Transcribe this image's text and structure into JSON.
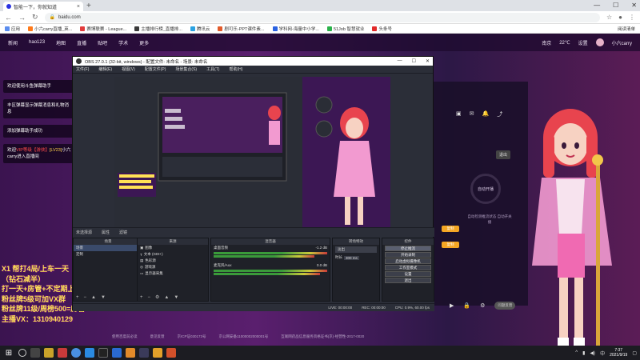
{
  "browser": {
    "tab_title": "智能一下，你就知道",
    "address": "baidu.com",
    "bookmarks": [
      "应用",
      "小六carry直播_英...",
      "赛博联赛 - League...",
      "主播排行榜_直播排...",
      "腾讯云",
      "剧可乐-PPT课件素...",
      "学科网-海量中小学...",
      "51Job 智慧就业",
      "头条号"
    ],
    "bookmarks_right": "阅读清单"
  },
  "site_nav": {
    "items": [
      "新闻",
      "hao123",
      "地图",
      "直播",
      "贴吧",
      "学术",
      "更多"
    ],
    "right": [
      "南京",
      "22℃",
      "设置",
      "小六carry"
    ]
  },
  "chat": [
    {
      "text": "欢迎使用斗鱼弹幕助手"
    },
    {
      "text": "丰区弹幕显示弹幕消息和礼物消息"
    },
    {
      "text": "添加弹幕助手成功"
    },
    {
      "pre": "欢迎",
      "hl": "VIP等级",
      "mid": "【游侠】",
      "lvl": "[LV23]",
      "post": "小六carry进入直播间"
    }
  ],
  "promo": [
    "X1 帮打4局/上车一天",
    "（钻石减半）",
    "打一天+房管+不定期上分",
    "粉丝牌5级可加VX群",
    "粉丝牌11级/周榜500=房管",
    "主播VX：1310940129"
  ],
  "obs": {
    "title": "OBS 27.0.1 (32-bit, windows) - 配置文件: 未命名 - 场景: 未命名",
    "menu": [
      "文件(F)",
      "编辑(E)",
      "视图(V)",
      "配置文件(P)",
      "场景集合(S)",
      "工具(T)",
      "帮助(H)"
    ],
    "selection_bar": [
      "未选择源",
      "属性",
      "滤镜"
    ],
    "scenes_header": "场景",
    "scenes": [
      "场景",
      "定制"
    ],
    "sources_header": "来源",
    "sources": [
      "图像",
      "文本 (GDI+)",
      "色彩源",
      "游戏源",
      "显示器采集"
    ],
    "mixer_header": "混音器",
    "mixer": [
      {
        "name": "桌面音频",
        "db": "-1.2 dB"
      },
      {
        "name": "麦克风/Aux",
        "db": "0.0 dB"
      }
    ],
    "transitions_header": "转场特效",
    "transition_type": "淡出",
    "duration_label": "时长",
    "duration_value": "300 ms",
    "controls_header": "控件",
    "controls": [
      "停止推流",
      "开始录制",
      "启动虚拟摄像机",
      "工作室模式",
      "设置",
      "退出"
    ],
    "status": [
      "LIVE: 00:00:00",
      "REC: 00:00:00",
      "CPU: 0.9%, 60.00 fps"
    ]
  },
  "right_panel": {
    "exit_label": "退出",
    "circle_label": "自动开播",
    "note": "自动检测推流状态 自动开关播",
    "btn1": "复制",
    "btn2": "复制",
    "search_placeholder": "问题反馈"
  },
  "footer_links": [
    "使用百度前必读",
    "意见反馈",
    "京ICP证030173号",
    "京公网安备11000002000001号",
    "互联网药品信息服务资格证书(京)-经营性-2017-0020"
  ],
  "taskbar": {
    "time": "7:37",
    "date": "2021/9/19",
    "lang": "中"
  },
  "colors": {
    "obs_bg": "#2b2e38",
    "promo_yellow": "#ffe255",
    "page_purple": "#5a1f6e"
  }
}
